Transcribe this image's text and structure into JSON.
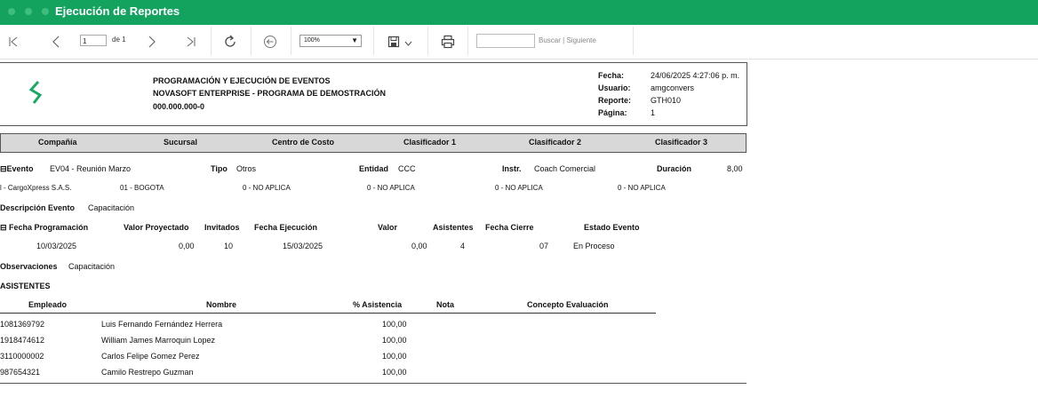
{
  "window": {
    "title": "Ejecución de Reportes"
  },
  "toolbar": {
    "page_value": "1",
    "page_of": "de 1",
    "zoom": "100%",
    "search_placeholder": "",
    "search_label": "Buscar",
    "search_sep": "|",
    "next_label": "Siguiente"
  },
  "report": {
    "heading_line1": "PROGRAMACIÓN Y EJECUCIÓN DE EVENTOS",
    "heading_line2": "NOVASOFT ENTERPRISE - PROGRAMA DE DEMOSTRACIÓN",
    "heading_line3": "000.000.000-0",
    "meta": {
      "fecha_label": "Fecha:",
      "fecha": "24/06/2025 4:27:06 p. m.",
      "usuario_label": "Usuario:",
      "usuario": "amgconvers",
      "reporte_label": "Reporte:",
      "reporte": "GTH010",
      "pagina_label": "Página:",
      "pagina": "1"
    },
    "columns": [
      "Compañía",
      "Sucursal",
      "Centro de Costo",
      "Clasificador 1",
      "Clasificador 2",
      "Clasificador 3"
    ],
    "evento": {
      "label": "⊟Evento",
      "value": "EV04 - Reunión Marzo",
      "tipo_label": "Tipo",
      "tipo": "Otros",
      "entidad_label": "Entidad",
      "entidad": "CCC",
      "instr_label": "Instr.",
      "instr": "Coach Comercial",
      "duracion_label": "Duración",
      "duracion": "8,00"
    },
    "org_row": [
      "l - CargoXpress S.A.S.",
      "01 - BOGOTA",
      "0 - NO APLICA",
      "0 - NO APLICA",
      "0 - NO APLICA",
      "0 - NO APLICA"
    ],
    "descripcion_label": "Descripción Evento",
    "descripcion": "Capacitación",
    "prog_headers": {
      "fecha_prog": "⊟ Fecha Programación",
      "valor_proy": "Valor Proyectado",
      "invitados": "Invitados",
      "fecha_ejec": "Fecha Ejecución",
      "valor": "Valor",
      "asistentes": "Asistentes",
      "fecha_cierre": "Fecha Cierre",
      "estado": "Estado Evento"
    },
    "prog_row": {
      "fecha_prog": "10/03/2025",
      "valor_proy": "0,00",
      "invitados": "10",
      "fecha_ejec": "15/03/2025",
      "valor": "0,00",
      "asistentes": "4",
      "fecha_cierre": "07",
      "estado": "En Proceso"
    },
    "observaciones_label": "Observaciones",
    "observaciones": "Capacitación",
    "asistentes_title": "ASISTENTES",
    "att_headers": {
      "empleado": "Empleado",
      "nombre": "Nombre",
      "asistencia": "% Asistencia",
      "nota": "Nota",
      "concepto": "Concepto Evaluación"
    },
    "attendees": [
      {
        "empleado": "1081369792",
        "nombre": "Luis Fernando Fernández Herrera",
        "asistencia": "100,00"
      },
      {
        "empleado": "1918474612",
        "nombre": "William James Marroquin Lopez",
        "asistencia": "100,00"
      },
      {
        "empleado": "3110000002",
        "nombre": "Carlos Felipe Gomez Perez",
        "asistencia": "100,00"
      },
      {
        "empleado": "987654321",
        "nombre": "Camilo Restrepo Guzman",
        "asistencia": "100,00"
      }
    ]
  },
  "colors": {
    "titlebar": "#13a35f",
    "logo": "#1aa866"
  }
}
